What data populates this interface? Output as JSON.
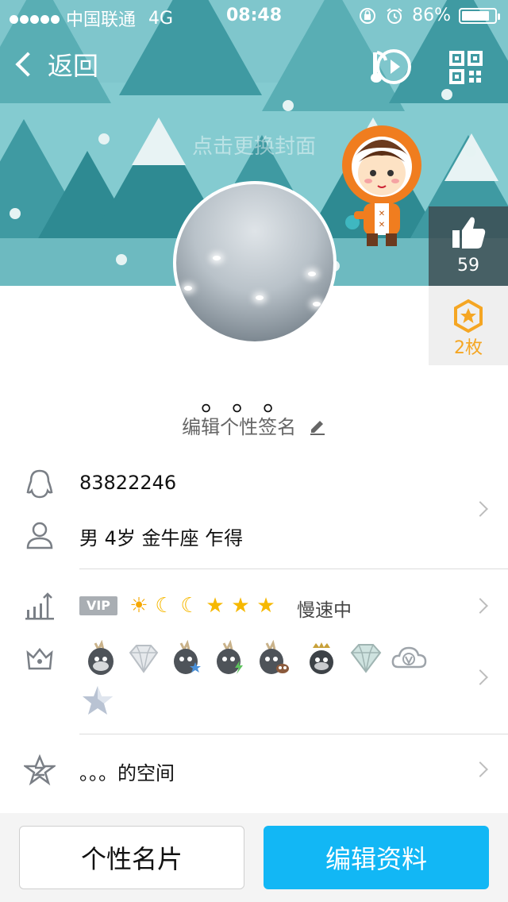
{
  "status_bar": {
    "carrier": "中国联通",
    "network": "4G",
    "time": "08:48",
    "battery": "86%"
  },
  "nav": {
    "back_label": "返回"
  },
  "cover": {
    "hint": "点击更换封面"
  },
  "side": {
    "like_count": "59",
    "medal_count": "2枚"
  },
  "profile": {
    "nickname": "。。。",
    "signature": "编辑个性签名"
  },
  "info": {
    "qq_number": "83822246",
    "details": "男 4岁 金牛座 乍得",
    "vip_label": "VIP",
    "level_icons": [
      "sun",
      "moon",
      "moon",
      "star",
      "star",
      "star"
    ],
    "speed_label": "慢速中",
    "space_label": "。。。的空间"
  },
  "bottom": {
    "card_label": "个性名片",
    "edit_label": "编辑资料"
  },
  "colors": {
    "accent": "#12b7f5",
    "medal": "#f5a623",
    "cover": "#84cbd0"
  }
}
